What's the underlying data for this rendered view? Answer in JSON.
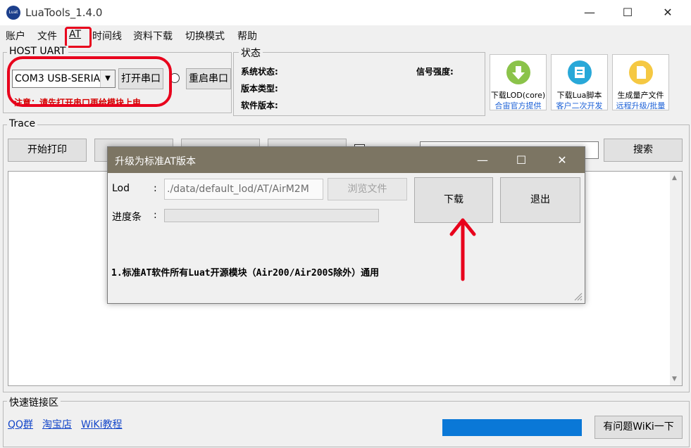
{
  "window": {
    "title": "LuaTools_1.4.0",
    "logo_text": "Luat"
  },
  "menu": [
    "账户",
    "文件",
    "AT",
    "时间线",
    "资料下载",
    "切换模式",
    "帮助"
  ],
  "host_uart": {
    "title": "HOST UART",
    "port_value": "COM3 USB-SERIA",
    "open_label": "打开串口",
    "restart_label": "重启串口",
    "warning": "注意：请先打开串口再给模块上电"
  },
  "status": {
    "title": "状态",
    "system_label": "系统状态:",
    "signal_label": "信号强度:",
    "version_type_label": "版本类型:",
    "software_label": "软件版本:"
  },
  "tools": [
    {
      "line1": "下载LOD(core)",
      "line2": "合宙官方提供",
      "icon": "download-arrow-icon",
      "color": "#8bc34a"
    },
    {
      "line1": "下载Lua脚本",
      "line2": "客户二次开发",
      "icon": "script-icon",
      "color": "#29a8d8"
    },
    {
      "line1": "生成量产文件",
      "line2": "远程升级/批量",
      "icon": "document-icon",
      "color": "#f5c842"
    }
  ],
  "trace": {
    "title": "Trace",
    "start_label": "开始打印",
    "search_label": "搜索"
  },
  "quick_links": {
    "title": "快速链接区",
    "links": [
      "QQ群",
      "淘宝店",
      "WiKi教程"
    ],
    "wiki_button": "有问题WiKi一下"
  },
  "dialog": {
    "title": "升级为标准AT版本",
    "lod_label": "Lod",
    "colon": ":",
    "lod_path": "./data/default_lod/AT/AirM2M",
    "browse_label": "浏览文件",
    "progress_label": "进度条",
    "download_label": "下载",
    "exit_label": "退出",
    "note": "1.标准AT软件所有Luat开源模块（Air200/Air200S除外）通用"
  }
}
